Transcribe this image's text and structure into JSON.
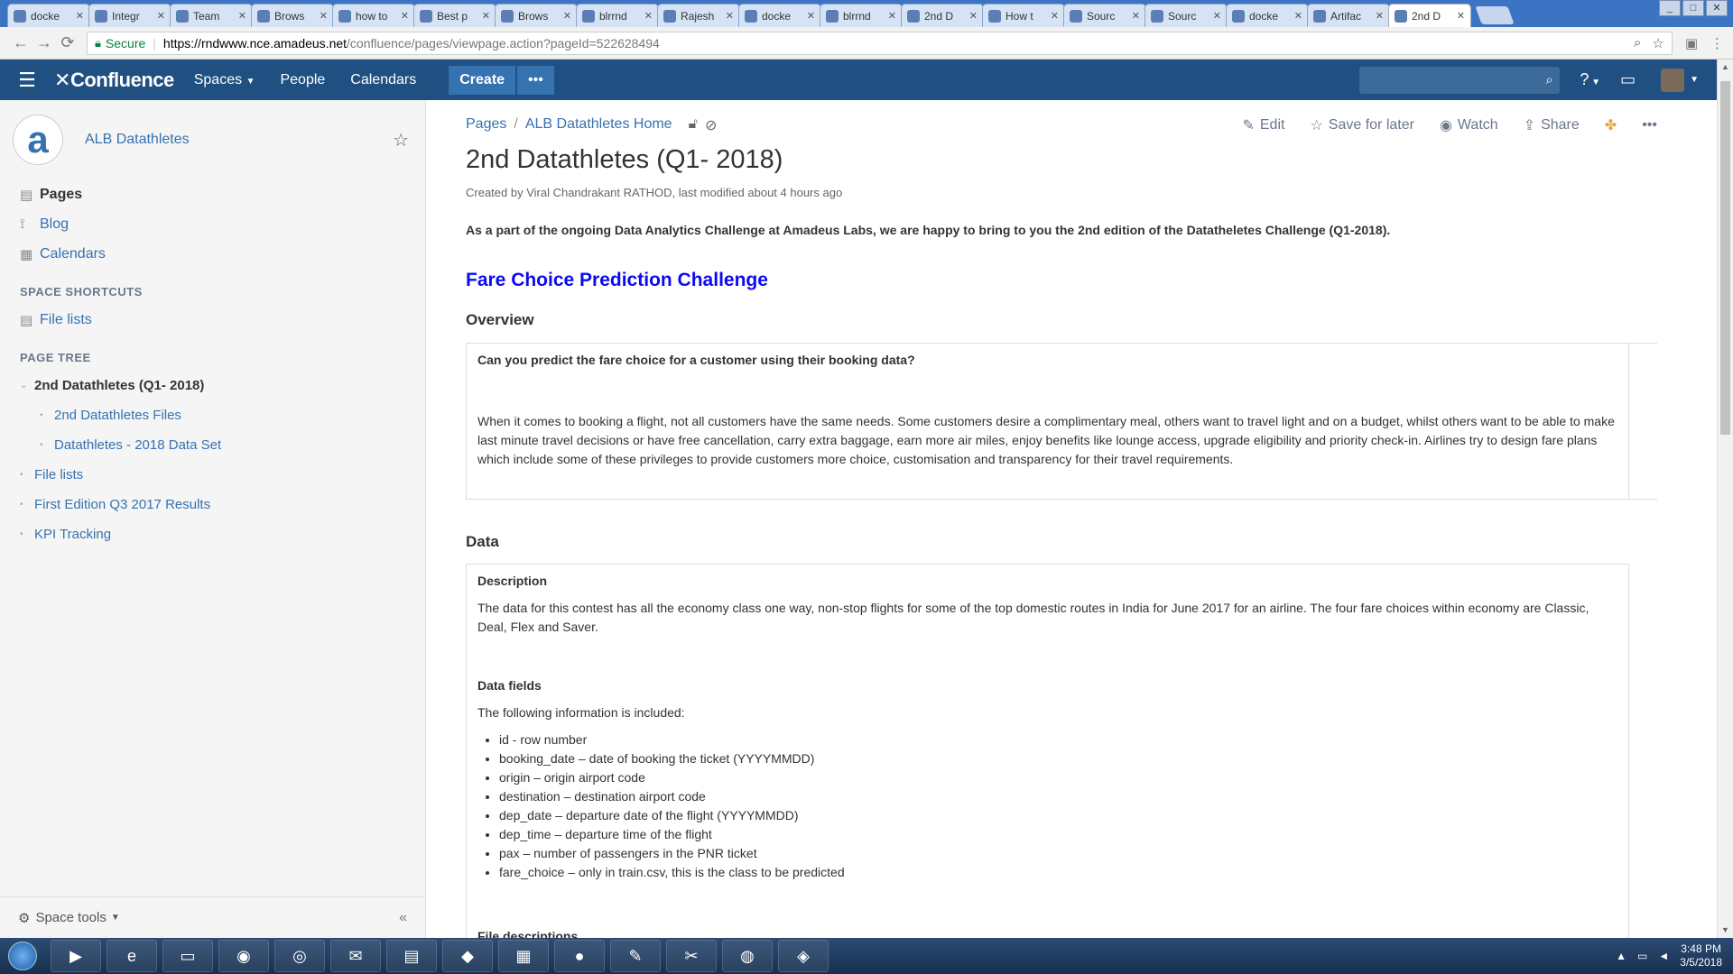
{
  "browser": {
    "tabs": [
      {
        "label": "docke",
        "icon": "confluence-icon"
      },
      {
        "label": "Integr",
        "icon": "jira-icon"
      },
      {
        "label": "Team",
        "icon": "confluence-icon"
      },
      {
        "label": "Brows",
        "icon": "bitbucket-icon"
      },
      {
        "label": "how to",
        "icon": "google-icon"
      },
      {
        "label": "Best p",
        "icon": "edge-icon"
      },
      {
        "label": "Brows",
        "icon": "bitbucket-icon"
      },
      {
        "label": "blrrnd",
        "icon": "page-icon"
      },
      {
        "label": "Rajesh",
        "icon": "quora-icon"
      },
      {
        "label": "docke",
        "icon": "edge-icon"
      },
      {
        "label": "blrrnd",
        "icon": "page-icon"
      },
      {
        "label": "2nd D",
        "icon": "confluence-icon"
      },
      {
        "label": "How t",
        "icon": "confluence-icon"
      },
      {
        "label": "Sourc",
        "icon": "bitbucket-icon"
      },
      {
        "label": "Sourc",
        "icon": "bitbucket-icon"
      },
      {
        "label": "docke",
        "icon": "google-icon"
      },
      {
        "label": "Artifac",
        "icon": "artifactory-icon"
      },
      {
        "label": "2nd D",
        "icon": "confluence-icon",
        "active": true
      }
    ],
    "secure_label": "Secure",
    "url_host": "https://rndwww.nce.amadeus.net",
    "url_path": "/confluence/pages/viewpage.action?pageId=522628494"
  },
  "header": {
    "logo": "Confluence",
    "nav": [
      "Spaces",
      "People",
      "Calendars"
    ],
    "create_label": "Create",
    "more_label": "•••"
  },
  "sidebar": {
    "space_name": "ALB Datathletes",
    "space_initial": "a",
    "nav": [
      {
        "label": "Pages",
        "icon": "pages-icon",
        "current": true
      },
      {
        "label": "Blog",
        "icon": "blog-icon"
      },
      {
        "label": "Calendars",
        "icon": "calendar-icon"
      }
    ],
    "shortcuts_title": "SPACE SHORTCUTS",
    "shortcuts": [
      {
        "label": "File lists",
        "icon": "file-icon"
      }
    ],
    "tree_title": "PAGE TREE",
    "tree": [
      {
        "label": "2nd Datathletes (Q1- 2018)",
        "current": true,
        "level": 0,
        "expanded": true
      },
      {
        "label": "2nd Datathletes Files",
        "level": 1
      },
      {
        "label": "Datathletes - 2018 Data Set",
        "level": 1
      },
      {
        "label": "File lists",
        "level": 0
      },
      {
        "label": "First Edition Q3 2017 Results",
        "level": 0
      },
      {
        "label": "KPI Tracking",
        "level": 0
      }
    ],
    "space_tools": "Space tools"
  },
  "page": {
    "breadcrumbs": [
      "Pages",
      "ALB Datathletes Home"
    ],
    "actions": {
      "edit": "Edit",
      "save": "Save for later",
      "watch": "Watch",
      "share": "Share"
    },
    "title": "2nd Datathletes (Q1- 2018)",
    "byline": "Created by Viral Chandrakant RATHOD, last modified about 4 hours ago",
    "intro": "As a part of the ongoing Data Analytics Challenge at Amadeus Labs, we are happy to bring to you the 2nd edition of the Datatheletes Challenge (Q1-2018).",
    "challenge_title": "Fare Choice Prediction Challenge",
    "overview_heading": "Overview",
    "overview_question": "Can you predict the fare choice for a customer using their booking data?",
    "overview_text": "When it comes to booking a flight, not all customers have the same needs. Some customers desire a complimentary meal, others want to travel light and on a budget, whilst others want to be able to make last minute travel decisions or have free cancellation, carry extra baggage, earn more air miles, enjoy benefits like lounge access, upgrade eligibility and priority check-in. Airlines try to design fare plans which include some of these privileges to provide customers more choice, customisation and transparency for their travel requirements.",
    "data_heading": "Data",
    "description_heading": "Description",
    "description_text": "The data for this contest has all the economy class one way, non-stop flights for some of the top domestic routes in India for June 2017 for an airline. The four fare choices within economy are Classic, Deal, Flex and Saver.",
    "fields_heading": "Data fields",
    "fields_intro": "The following information is included:",
    "fields": [
      "id -  row number",
      "booking_date – date of booking the ticket (YYYYMMDD)",
      "origin – origin airport code",
      "destination – destination airport code",
      "dep_date – departure date of the flight (YYYYMMDD)",
      "dep_time – departure time of the flight",
      "pax – number of passengers in the PNR ticket",
      "fare_choice – only in train.csv, this is the class to be predicted"
    ],
    "file_desc_heading": "File descriptions"
  },
  "taskbar": {
    "time": "3:48 PM",
    "date": "3/5/2018"
  },
  "colors": {
    "header_bg": "#205081",
    "link": "#3572b0",
    "challenge_title": "#0b0bf0"
  }
}
